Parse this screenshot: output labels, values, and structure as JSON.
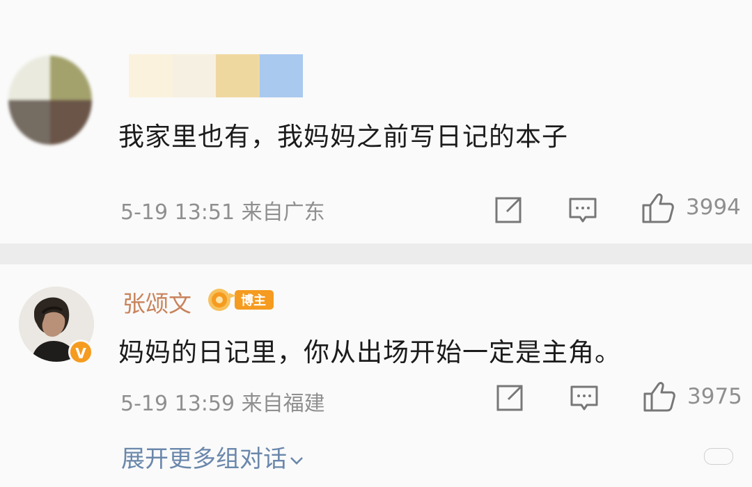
{
  "comments": [
    {
      "text": "我家里也有，我妈妈之前写日记的本子",
      "meta": "5-19 13:51 来自广东",
      "likes": "3994",
      "avatar_icon": "blurred-avatar",
      "name_blur_colors": [
        "#fbf2de",
        "#f6f0e2",
        "#efd8a0",
        "#a9c9ef"
      ]
    },
    {
      "username": "张颂文",
      "badge": "博主",
      "verified": "V",
      "text": "妈妈的日记里，你从出场开始一定是主角。",
      "meta": "5-19 13:59 来自福建",
      "likes": "3975",
      "avatar_icon": "user-avatar"
    }
  ],
  "expand_label": "展开更多组对话",
  "colors": {
    "username": "#c9835b",
    "link": "#6a87ab",
    "meta": "#8f8f8f",
    "badge": "#f59b20"
  },
  "icons": [
    "share-icon",
    "comment-icon",
    "thumbs-up-icon",
    "chevron-down-icon"
  ]
}
